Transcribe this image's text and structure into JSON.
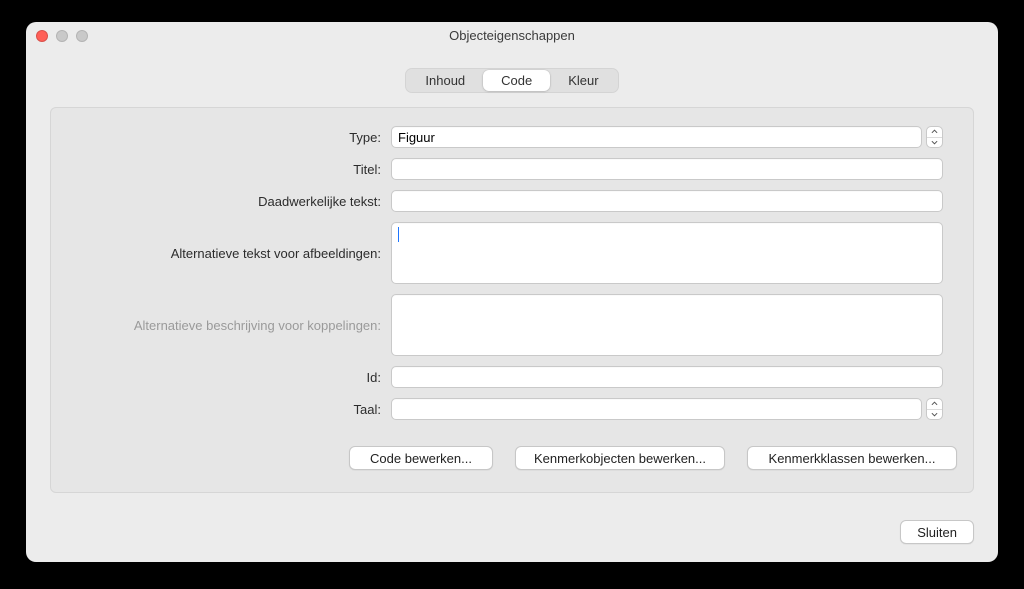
{
  "window": {
    "title": "Objecteigenschappen"
  },
  "tabs": {
    "items": [
      "Inhoud",
      "Code",
      "Kleur"
    ],
    "active": 1
  },
  "form": {
    "type": {
      "label": "Type:",
      "value": "Figuur"
    },
    "title": {
      "label": "Titel:",
      "value": ""
    },
    "actual": {
      "label": "Daadwerkelijke tekst:",
      "value": ""
    },
    "alt_img": {
      "label": "Alternatieve tekst voor afbeeldingen:",
      "value": ""
    },
    "alt_link": {
      "label": "Alternatieve beschrijving voor koppelingen:",
      "value": "",
      "disabled": true
    },
    "id": {
      "label": "Id:",
      "value": ""
    },
    "lang": {
      "label": "Taal:",
      "value": ""
    }
  },
  "buttons": {
    "edit_code": "Code bewerken...",
    "edit_attrs": "Kenmerkobjecten bewerken...",
    "edit_classes": "Kenmerkklassen bewerken...",
    "close": "Sluiten"
  }
}
